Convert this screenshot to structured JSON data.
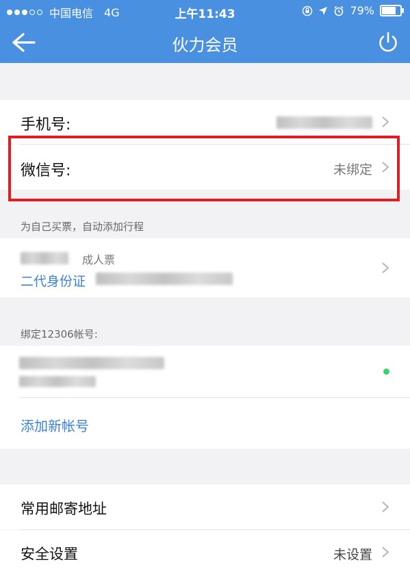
{
  "status_bar": {
    "carrier": "中国电信",
    "network": "4G",
    "time": "上午11:43",
    "battery": "79%"
  },
  "nav": {
    "title": "伙力会员"
  },
  "account": {
    "phone_label": "手机号:",
    "wechat_label": "微信号:",
    "wechat_value": "未绑定"
  },
  "passenger": {
    "caption": "为自己买票，自动添加行程",
    "ticket_type": "成人票",
    "id_type": "二代身份证"
  },
  "binding": {
    "caption": "绑定12306帐号:",
    "add_account": "添加新帐号"
  },
  "settings": {
    "mail_address": "常用邮寄地址",
    "security": "安全设置",
    "security_value": "未设置"
  }
}
